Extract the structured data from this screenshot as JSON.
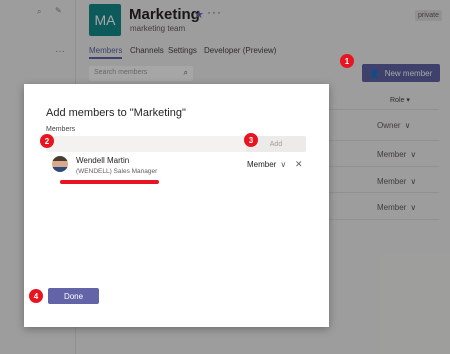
{
  "sidebar": {
    "search_icon": "search-icon",
    "compose_icon": "compose-icon",
    "more_icon": "more-icon",
    "more_label": "···"
  },
  "team": {
    "initials": "MA",
    "name": "Marketing",
    "description": "marketing team",
    "badge": "private",
    "tile_color": "#148a8a",
    "more_label": "···"
  },
  "tabs": [
    {
      "label": "Members"
    },
    {
      "label": "Channels"
    },
    {
      "label": "Settings"
    },
    {
      "label": "Developer (Preview)"
    }
  ],
  "search": {
    "placeholder": "Search members"
  },
  "new_member_button": {
    "label": "New member"
  },
  "table": {
    "role_header": "Role",
    "roles": [
      "Owner",
      "Member",
      "Member",
      "Member"
    ]
  },
  "dialog": {
    "title": "Add members to \"Marketing\"",
    "members_label": "Members",
    "add_label": "Add",
    "selected_member": {
      "name": "Wendell Martin",
      "title": "(WENDELL) Sales Manager",
      "role": "Member"
    },
    "done_label": "Done"
  },
  "callouts": [
    "1",
    "2",
    "3",
    "4"
  ],
  "colors": {
    "accent": "#6264a7",
    "callout": "#e8141f"
  }
}
